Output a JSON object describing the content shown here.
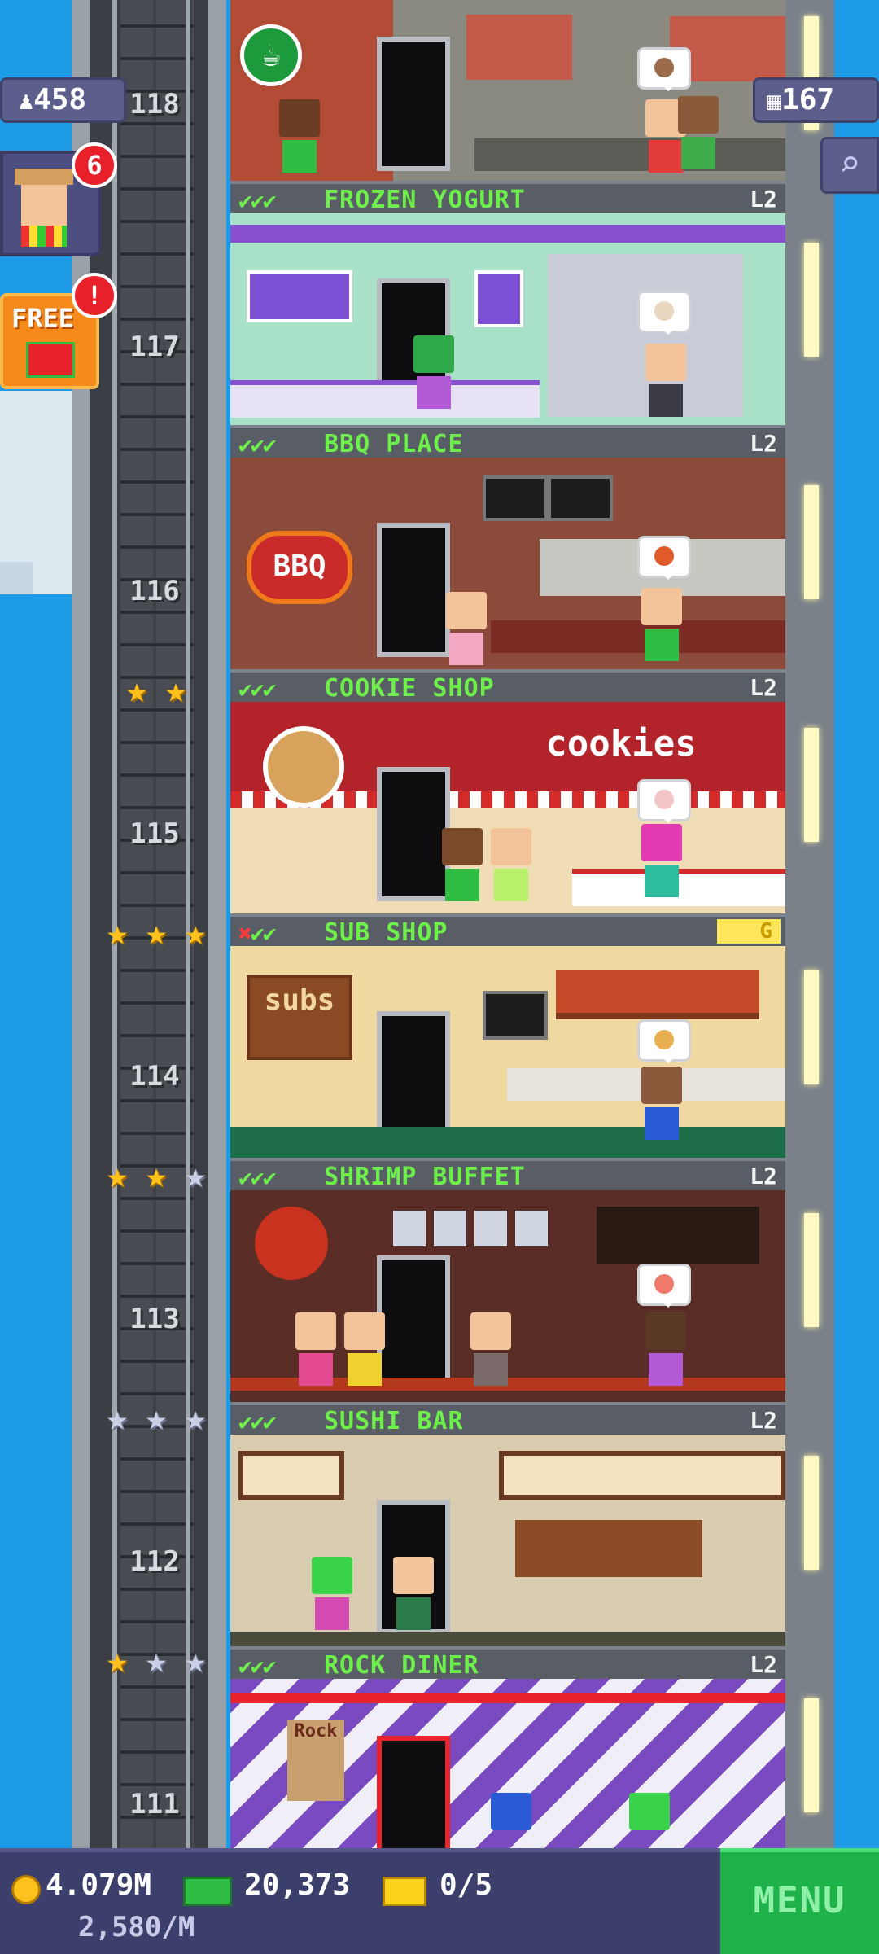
{
  "hud": {
    "population": "458",
    "floors": "167",
    "vip_badge": "6",
    "free_label": "FREE",
    "free_badge": "!",
    "coins": "4.079M",
    "coin_rate": "2,580/M",
    "bux": "20,373",
    "tickets": "0/5",
    "menu": "MENU"
  },
  "floors": [
    {
      "number": "118",
      "name": "FROZEN YOGURT",
      "level": "L2",
      "checks": [
        "ok",
        "ok",
        "ok"
      ]
    },
    {
      "number": "117",
      "name": "BBQ PLACE",
      "level": "L2",
      "checks": [
        "ok",
        "ok",
        "ok"
      ]
    },
    {
      "number": "116",
      "name": "COOKIE SHOP",
      "level": "L2",
      "checks": [
        "ok",
        "ok",
        "ok"
      ],
      "sign": "BBQ"
    },
    {
      "number": "115",
      "name": "SUB SHOP",
      "level": "G",
      "checks": [
        "x",
        "ok",
        "ok"
      ],
      "sign": "cookies"
    },
    {
      "number": "114",
      "name": "SHRIMP BUFFET",
      "level": "L2",
      "checks": [
        "ok",
        "ok",
        "ok"
      ],
      "sign": "subs"
    },
    {
      "number": "113",
      "name": "SUSHI BAR",
      "level": "L2",
      "checks": [
        "ok",
        "ok",
        "ok"
      ]
    },
    {
      "number": "112",
      "name": "ROCK DINER",
      "level": "L2",
      "checks": [
        "ok",
        "ok",
        "ok"
      ]
    },
    {
      "number": "111",
      "sign": "Rock"
    }
  ],
  "stars": {
    "row_116": [
      "gold",
      "gold"
    ],
    "row_115": [
      "gold",
      "gold",
      "gold"
    ],
    "row_114": [
      "gold",
      "gold",
      "silver"
    ],
    "row_113": [
      "silver",
      "silver",
      "silver"
    ],
    "row_112": [
      "gold",
      "silver",
      "silver"
    ]
  },
  "colors": {
    "sky": "#1e9be6",
    "label_green": "#6ef04a",
    "hud_purple": "#5c5f8c",
    "menu_green": "#1fb24a",
    "badge_red": "#e8202a"
  },
  "icons": [
    "population-icon",
    "floors-icon",
    "search-icon",
    "gift-icon",
    "coin-icon",
    "bux-icon",
    "ticket-icon",
    "coffee-icon",
    "star-icon",
    "check-icon"
  ]
}
